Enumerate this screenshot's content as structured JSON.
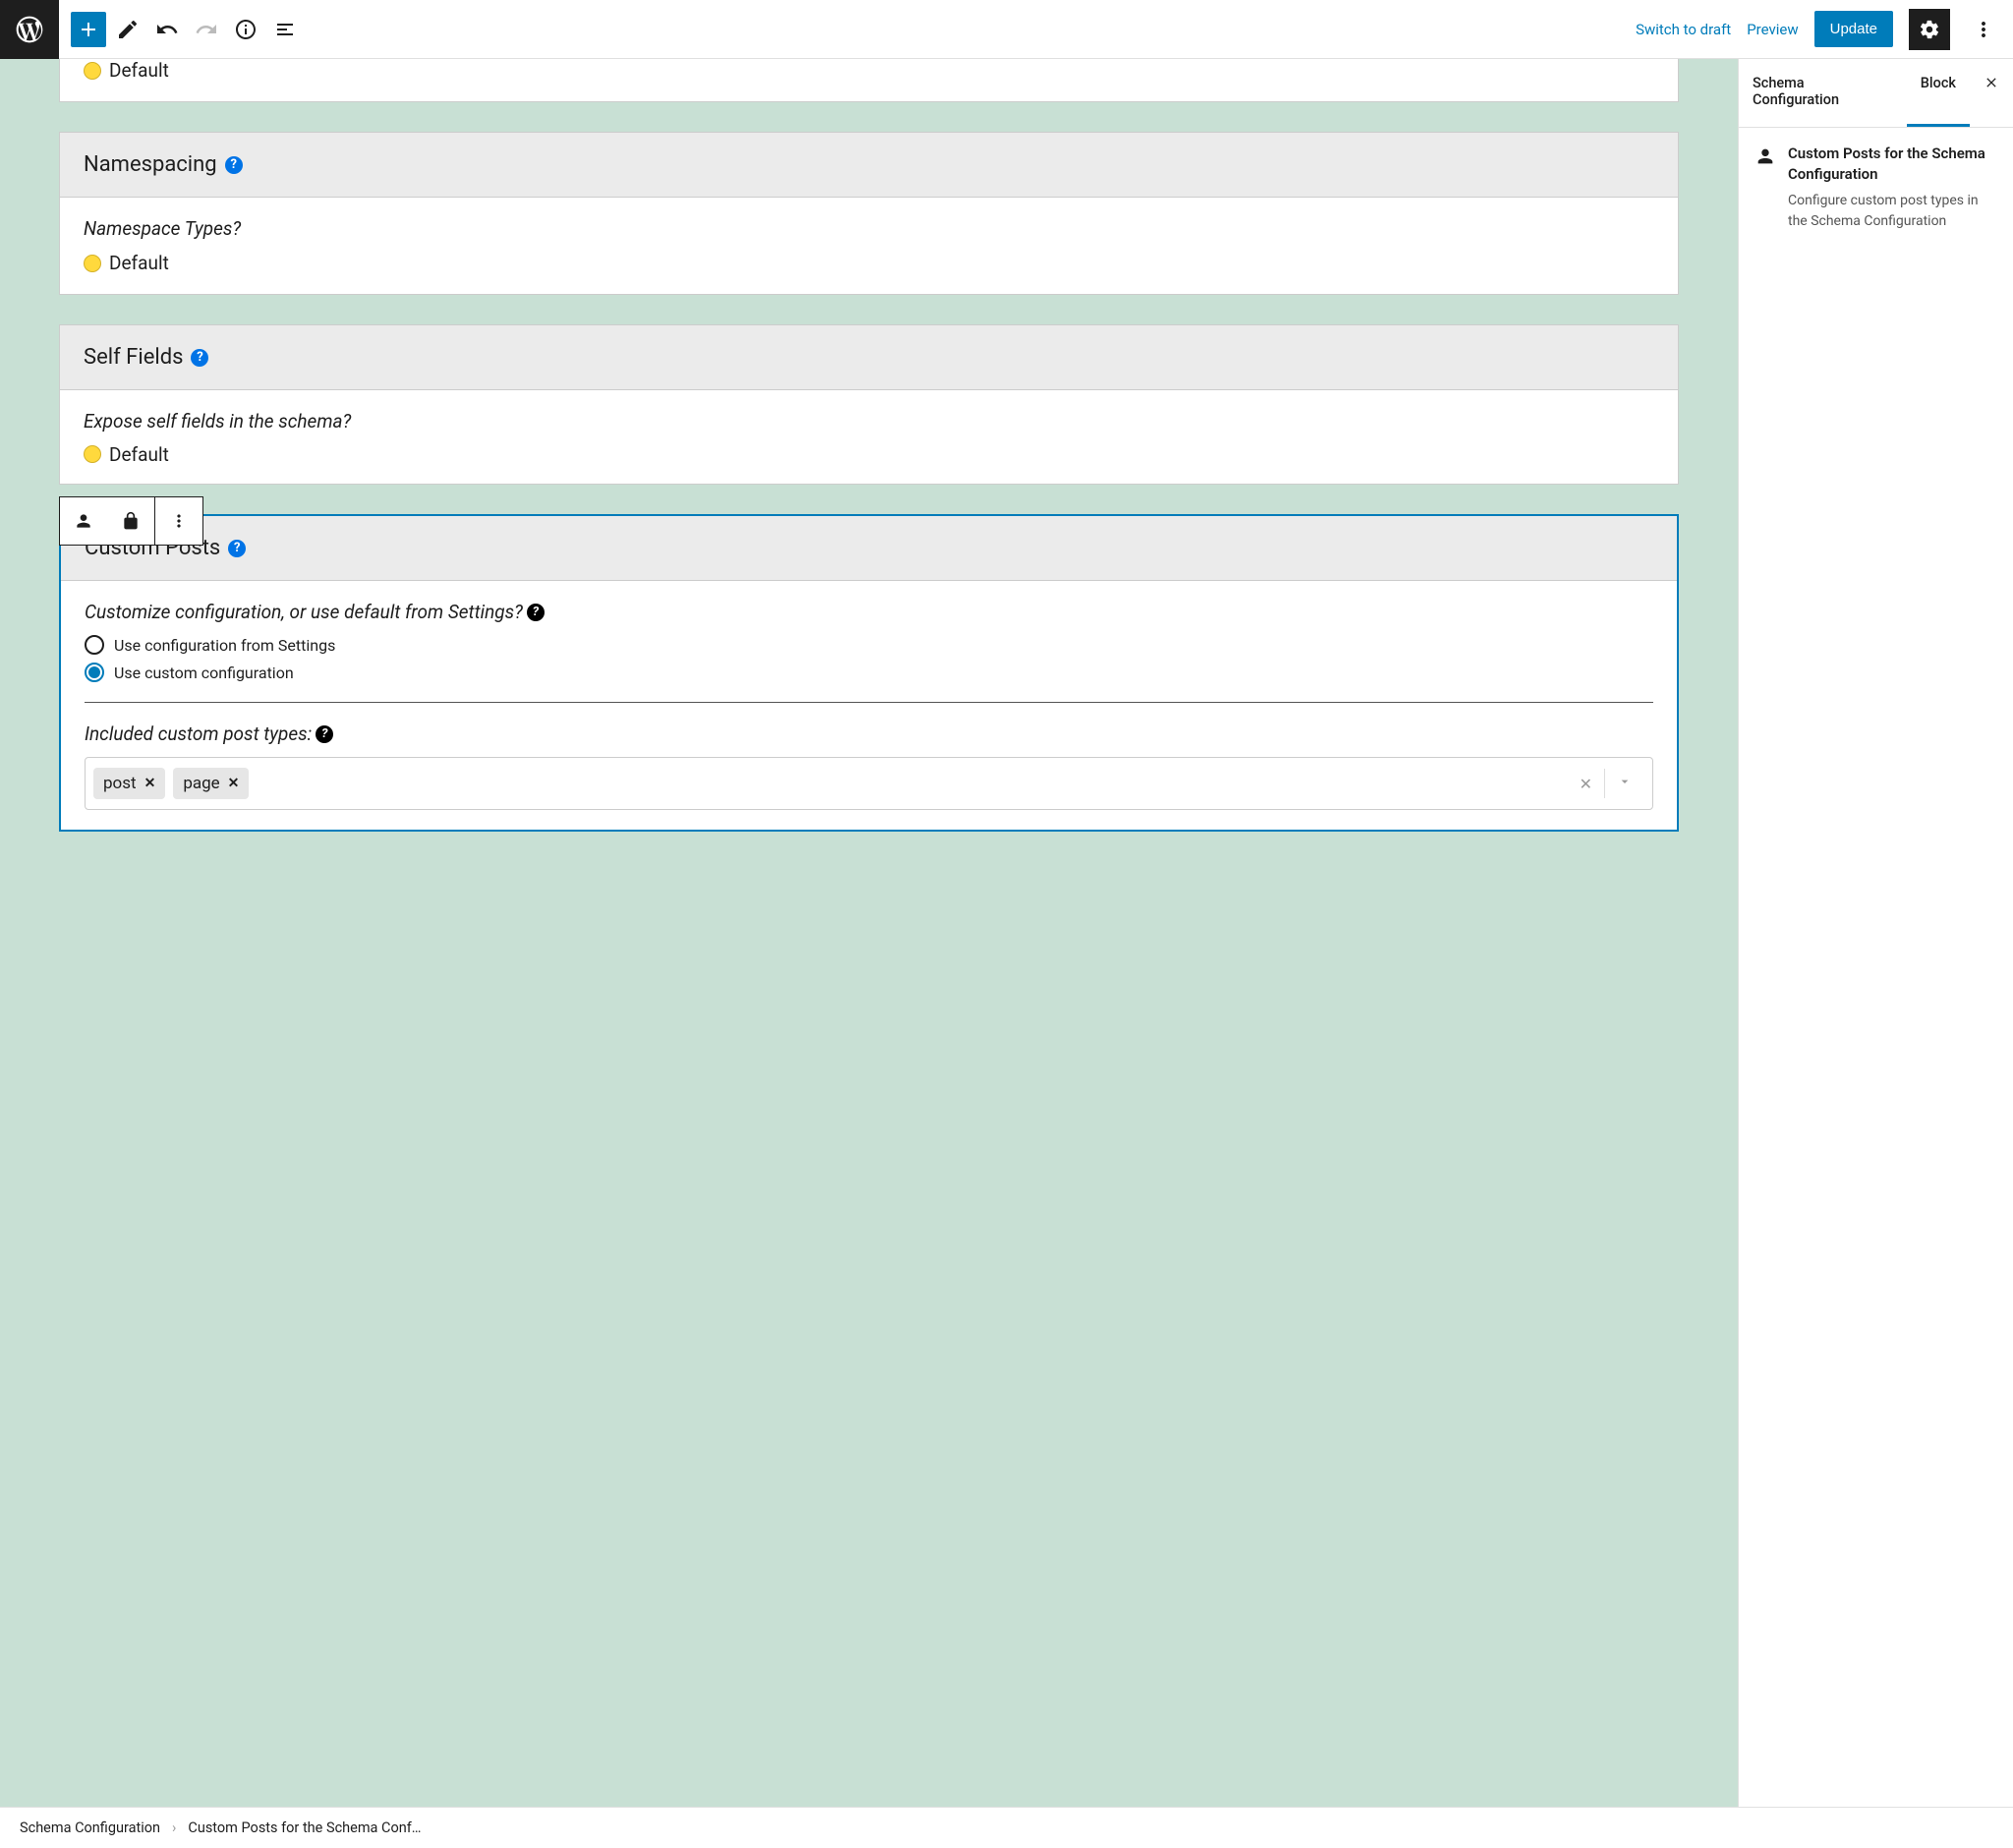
{
  "topbar": {
    "switch_draft": "Switch to draft",
    "preview": "Preview",
    "update": "Update"
  },
  "blocks": {
    "prev_default": "Default",
    "namespacing": {
      "title": "Namespacing",
      "question": "Namespace Types?",
      "value": "Default"
    },
    "self_fields": {
      "title": "Self Fields",
      "question": "Expose self fields in the schema?",
      "value": "Default"
    },
    "custom_posts": {
      "title": "Custom Posts",
      "question": "Customize configuration, or use default from Settings?",
      "option_default": "Use configuration from Settings",
      "option_custom": "Use custom configuration",
      "included_label": "Included custom post types:",
      "tags": {
        "t0": "post",
        "t1": "page"
      }
    }
  },
  "panel": {
    "tab_schema": "Schema Configuration",
    "tab_block": "Block",
    "block_title": "Custom Posts for the Schema Configuration",
    "block_desc": "Configure custom post types in the Schema Configuration"
  },
  "footer": {
    "crumb1": "Schema Configuration",
    "crumb2": "Custom Posts for the Schema Conf…"
  }
}
